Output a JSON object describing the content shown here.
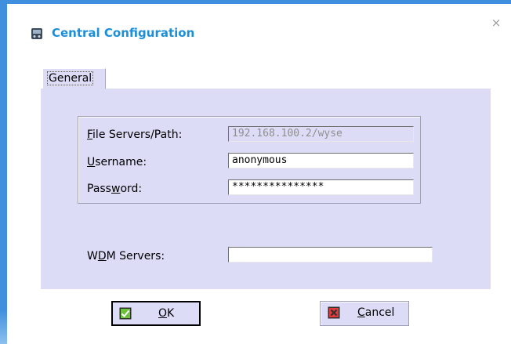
{
  "dialog": {
    "title": "Central Configuration",
    "close_glyph": "×",
    "title_icon": "network-drive-icon"
  },
  "tabs": [
    {
      "label": "General",
      "selected": true
    }
  ],
  "form": {
    "file_servers": {
      "label_pre": "F",
      "label_rest": "ile Servers/Path:",
      "value": "192.168.100.2/wyse",
      "enabled": false
    },
    "username": {
      "label_pre": "U",
      "label_rest": "sername:",
      "value": "anonymous"
    },
    "password": {
      "label_pre": "Pass",
      "label_mn": "w",
      "label_rest": "ord:",
      "value": "***************"
    },
    "wdm_servers": {
      "label_pre": "W",
      "label_mn": "D",
      "label_rest": "M Servers:",
      "value": ""
    }
  },
  "buttons": {
    "ok": {
      "label_mn": "O",
      "label_rest": "K",
      "icon": "check-icon",
      "icon_color": "#6cc23a"
    },
    "cancel": {
      "label_mn": "C",
      "label_rest": "ancel",
      "icon": "x-icon",
      "icon_color": "#e03a3a"
    }
  },
  "colors": {
    "accent": "#1d8ed8",
    "panel": "#dcdcf7",
    "window_edge": "#3f8fde"
  }
}
